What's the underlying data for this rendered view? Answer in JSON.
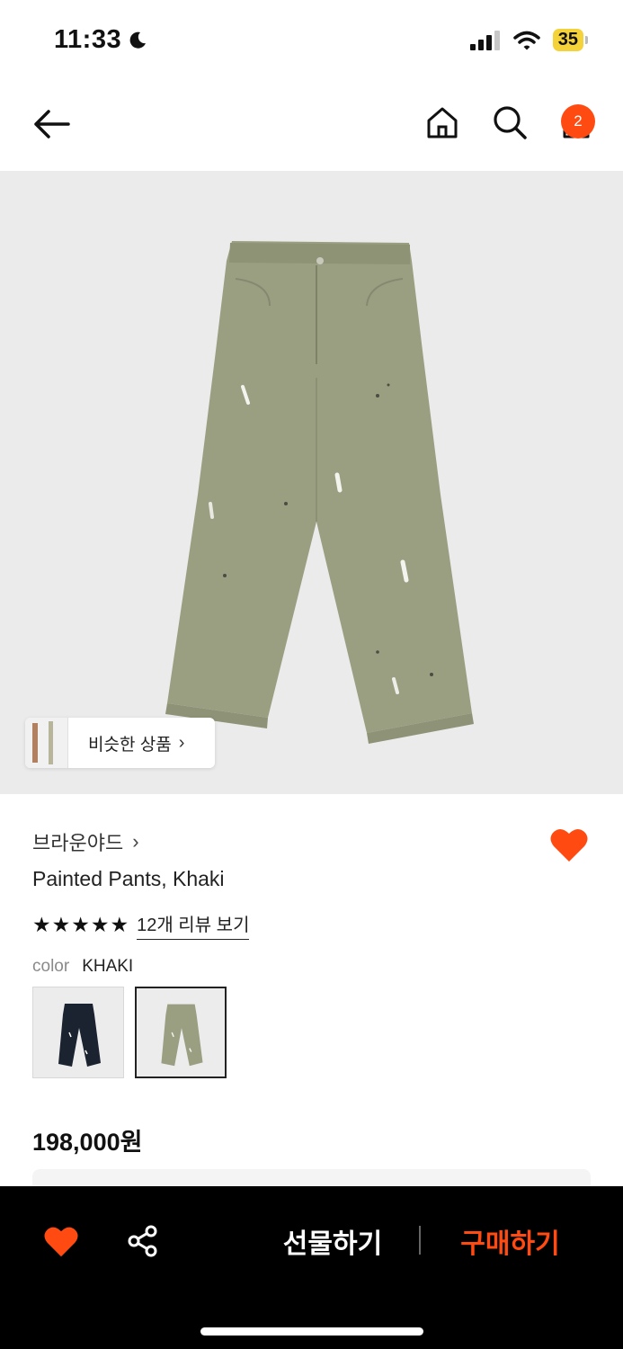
{
  "status_bar": {
    "time": "11:33",
    "battery": "35"
  },
  "nav": {
    "cart_count": "2",
    "icons": [
      "back-arrow-icon",
      "home-icon",
      "search-icon",
      "shopping-bag-icon"
    ]
  },
  "product": {
    "similar_label": "비슷한 상품",
    "brand": "브라운야드",
    "name": "Painted Pants, Khaki",
    "rating": 5,
    "stars": "★★★★★",
    "review_link": "12개 리뷰 보기",
    "color_key": "color",
    "color_value": "KHAKI",
    "swatches": [
      "black",
      "khaki"
    ],
    "selected_swatch": "khaki",
    "price": "198,000원"
  },
  "bottom_bar": {
    "gift_label": "선물하기",
    "buy_label": "구매하기"
  },
  "colors": {
    "accent": "#ff4b11",
    "khaki": "#9b9f82",
    "navy": "#1b2230",
    "image_bg": "#ebebeb"
  }
}
